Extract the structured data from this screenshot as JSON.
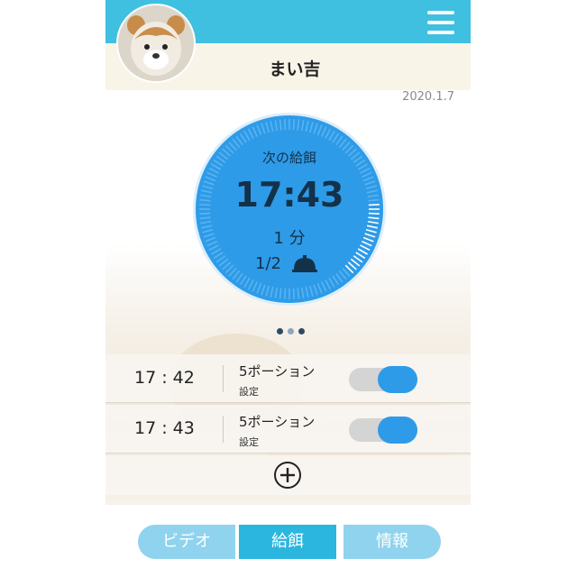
{
  "header": {
    "pet_name": "まい吉",
    "date": "2020.1.7",
    "menu_icon": "hamburger-menu-icon",
    "avatar_icon": "pet-avatar-photo"
  },
  "dial": {
    "title": "次の給餌",
    "time": "17:43",
    "duration": "1 分",
    "count": "1/2",
    "count_icon": "food-bowl-icon",
    "progress_fraction": 0.12
  },
  "pager": {
    "pages": 3,
    "active": 0
  },
  "schedule": {
    "rows": [
      {
        "time": "17 : 42",
        "portion": "5ポーション",
        "setting": "設定",
        "enabled": true
      },
      {
        "time": "17 : 43",
        "portion": "5ポーション",
        "setting": "設定",
        "enabled": true
      }
    ],
    "add_icon": "plus-circle-icon"
  },
  "tabs": [
    {
      "label": "ビデオ",
      "active": false
    },
    {
      "label": "給餌",
      "active": true
    },
    {
      "label": "情報",
      "active": false
    }
  ],
  "colors": {
    "header": "#3fc0e0",
    "dial": "#2e9be8",
    "tab_inactive": "#8fd3ee",
    "tab_active": "#2bb6df",
    "toggle_on": "#2e9be8"
  }
}
